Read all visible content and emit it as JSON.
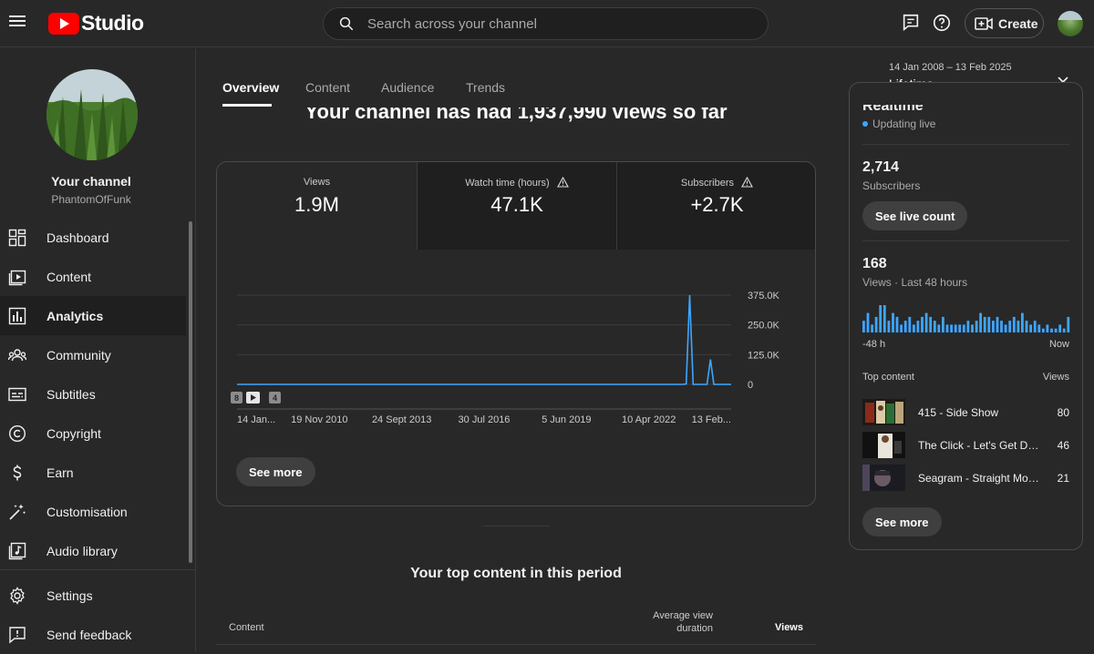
{
  "header": {
    "logo_text": "Studio",
    "search_placeholder": "Search across your channel",
    "create_label": "Create"
  },
  "sidebar": {
    "channel_title": "Your channel",
    "channel_handle": "PhantomOfFunk",
    "items": [
      {
        "label": "Dashboard",
        "icon": "dashboard-icon"
      },
      {
        "label": "Content",
        "icon": "content-icon"
      },
      {
        "label": "Analytics",
        "icon": "analytics-icon",
        "active": true
      },
      {
        "label": "Community",
        "icon": "community-icon"
      },
      {
        "label": "Subtitles",
        "icon": "subtitles-icon"
      },
      {
        "label": "Copyright",
        "icon": "copyright-icon"
      },
      {
        "label": "Earn",
        "icon": "earn-icon"
      },
      {
        "label": "Customisation",
        "icon": "customisation-icon"
      },
      {
        "label": "Audio library",
        "icon": "audio-library-icon"
      }
    ],
    "bottom_items": [
      {
        "label": "Settings",
        "icon": "gear-icon"
      },
      {
        "label": "Send feedback",
        "icon": "feedback-icon"
      }
    ]
  },
  "tabs": [
    "Overview",
    "Content",
    "Audience",
    "Trends"
  ],
  "date_picker": {
    "range": "14 Jan 2008 – 13 Feb 2025",
    "label": "Lifetime"
  },
  "overview": {
    "headline": "Your channel has had 1,937,990 views so far",
    "metrics": [
      {
        "label": "Views",
        "value": "1.9M",
        "warning": false
      },
      {
        "label": "Watch time (hours)",
        "value": "47.1K",
        "warning": true
      },
      {
        "label": "Subscribers",
        "value": "+2.7K",
        "warning": true
      }
    ],
    "see_more": "See more",
    "markers": [
      "8",
      "4"
    ]
  },
  "chart_data": {
    "type": "line",
    "series": [
      {
        "values": [
          0,
          0,
          0,
          0,
          0,
          0,
          0,
          0,
          0,
          0,
          0,
          0,
          0,
          0,
          0,
          0,
          0,
          0,
          0,
          0,
          0,
          0,
          0,
          0,
          0,
          0,
          0,
          0,
          0,
          0,
          0,
          0,
          0,
          0,
          0,
          0,
          0,
          0,
          0,
          0,
          0,
          0,
          0,
          0,
          0,
          0,
          0,
          0,
          0,
          0,
          0,
          0,
          0,
          0,
          0,
          0,
          0,
          0,
          0,
          0,
          0,
          0,
          0,
          0,
          0,
          0,
          0,
          0,
          0,
          0,
          0,
          0,
          0,
          0,
          0,
          0,
          0,
          0,
          0,
          0,
          0,
          0,
          0,
          0,
          0,
          0,
          0,
          0,
          0,
          0,
          0,
          0,
          0,
          0,
          0,
          0,
          0,
          0,
          0,
          0,
          0,
          0,
          0,
          0,
          0,
          0,
          0,
          0,
          0,
          0,
          0,
          0,
          0,
          0,
          0,
          0,
          0,
          0,
          0,
          0,
          0,
          0,
          0,
          0,
          0,
          0,
          0,
          0,
          0,
          0,
          2000,
          375000,
          0,
          0,
          0,
          0,
          0,
          105000,
          0,
          0,
          0,
          0,
          0,
          0
        ]
      }
    ],
    "x_ticks": [
      "14 Jan...",
      "19 Nov 2010",
      "24 Sept 2013",
      "30 Jul 2016",
      "5 Jun 2019",
      "10 Apr 2022",
      "13 Feb..."
    ],
    "y_ticks": [
      "375.0K",
      "250.0K",
      "125.0K",
      "0"
    ],
    "ylim": [
      0,
      375000
    ],
    "line_color": "#3ea6ff",
    "grid": true
  },
  "realtime": {
    "title": "Realtime",
    "status": "Updating live",
    "subscribers_value": "2,714",
    "subscribers_label": "Subscribers",
    "live_count_button": "See live count",
    "views_value": "168",
    "views_label": "Views · Last 48 hours",
    "axis_start": "-48 h",
    "axis_end": "Now",
    "hourly_views": [
      3,
      5,
      2,
      4,
      7,
      7,
      3,
      5,
      4,
      2,
      3,
      4,
      2,
      3,
      4,
      5,
      4,
      3,
      2,
      4,
      2,
      2,
      2,
      2,
      2,
      3,
      2,
      3,
      5,
      4,
      4,
      3,
      4,
      3,
      2,
      3,
      4,
      3,
      5,
      3,
      2,
      3,
      2,
      1,
      2,
      1,
      1,
      2,
      1,
      4
    ],
    "top_content_label": "Top content",
    "top_content_views_label": "Views",
    "top_content": [
      {
        "title": "415 - Side Show",
        "views": "80"
      },
      {
        "title": "The Click - Let's Get Dru...",
        "views": "46"
      },
      {
        "title": "Seagram - Straight Mob...",
        "views": "21"
      }
    ],
    "see_more": "See more"
  },
  "top_content_period": {
    "title": "Your top content in this period",
    "col_content": "Content",
    "col_avg_duration": "Average view duration",
    "col_views": "Views"
  }
}
